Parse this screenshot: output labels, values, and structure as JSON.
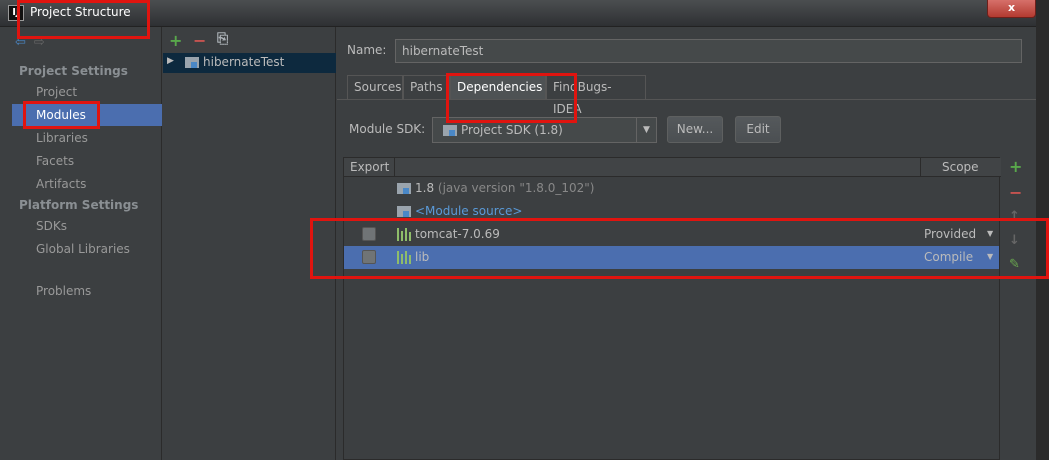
{
  "window": {
    "title": "Project Structure",
    "app_icon_text": "IJ",
    "close_label": "x"
  },
  "sidebar": {
    "sections": [
      {
        "label": "Project Settings"
      },
      {
        "label": "Platform Settings"
      }
    ],
    "items": [
      {
        "label": "Project"
      },
      {
        "label": "Modules"
      },
      {
        "label": "Libraries"
      },
      {
        "label": "Facets"
      },
      {
        "label": "Artifacts"
      },
      {
        "label": "SDKs"
      },
      {
        "label": "Global Libraries"
      },
      {
        "label": "Problems"
      }
    ],
    "selected": "Modules"
  },
  "tree": {
    "module_name": "hibernateTest"
  },
  "main": {
    "name_label": "Name:",
    "name_value": "hibernateTest",
    "tabs": [
      {
        "label": "Sources"
      },
      {
        "label": "Paths"
      },
      {
        "label": "Dependencies"
      },
      {
        "label": "FindBugs-IDEA"
      }
    ],
    "active_tab": "Dependencies",
    "module_sdk_label": "Module SDK:",
    "module_sdk_value": "Project SDK (1.8)",
    "new_button": "New...",
    "edit_button": "Edit",
    "table": {
      "headers": {
        "export": "Export",
        "scope": "Scope"
      },
      "rows": [
        {
          "name": "1.8",
          "detail": " (java version \"1.8.0_102\")",
          "scope": "",
          "checkbox": false
        },
        {
          "name": "<Module source>",
          "detail": "",
          "scope": "",
          "checkbox": false
        },
        {
          "name": "tomcat-7.0.69",
          "detail": "",
          "scope": "Provided",
          "checkbox": true
        },
        {
          "name": "lib",
          "detail": "",
          "scope": "Compile",
          "checkbox": true,
          "selected": true
        }
      ]
    }
  },
  "colors": {
    "background": "#3c3f41",
    "selection": "#4b6eaf",
    "highlight_box": "#e0140f",
    "add_green": "#59a84b",
    "remove_red": "#c75450"
  }
}
